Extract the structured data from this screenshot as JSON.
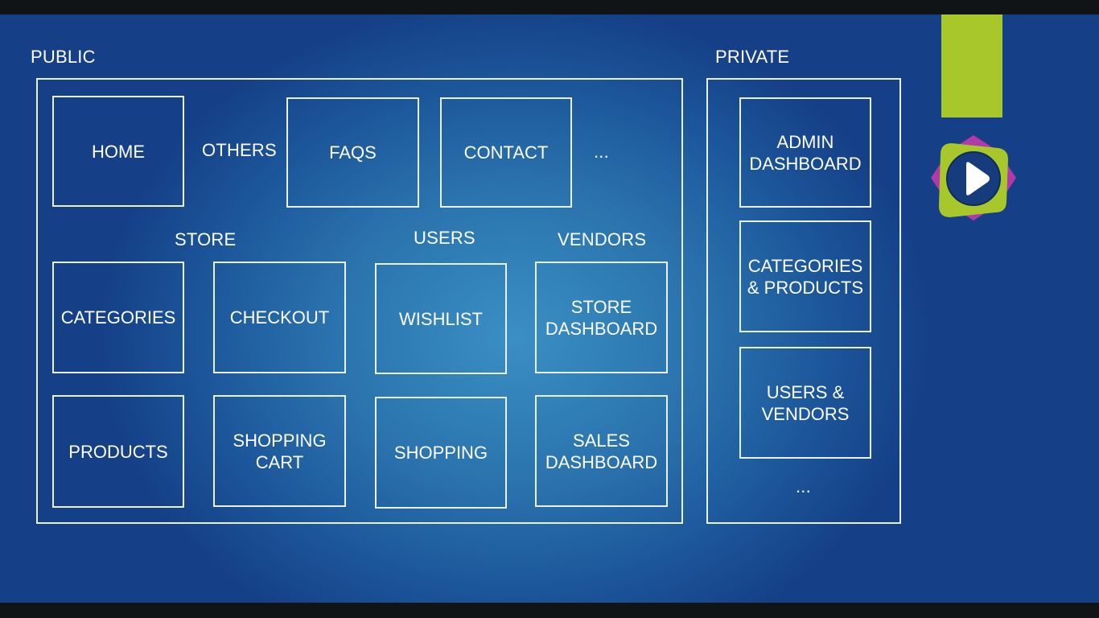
{
  "public": {
    "title": "PUBLIC",
    "others_label": "OTHERS",
    "others_more": "...",
    "store_label": "STORE",
    "users_label": "USERS",
    "vendors_label": "VENDORS",
    "boxes": {
      "home": "HOME",
      "faqs": "FAQS",
      "contact": "CONTACT",
      "categories": "CATEGORIES",
      "checkout": "CHECKOUT",
      "wishlist": "WISHLIST",
      "store_dashboard": "STORE\nDASHBOARD",
      "products": "PRODUCTS",
      "shopping_cart": "SHOPPING\nCART",
      "shopping": "SHOPPING",
      "sales_dashboard": "SALES\nDASHBOARD"
    }
  },
  "private": {
    "title": "PRIVATE",
    "more": "...",
    "boxes": {
      "admin_dashboard": "ADMIN\nDASHBOARD",
      "categories_products": "CATEGORIES\n& PRODUCTS",
      "users_vendors": "USERS &\nVENDORS"
    }
  },
  "colors": {
    "accent": "#a8c72a",
    "badge_magenta": "#b03aa8",
    "badge_navy": "#173c7e",
    "line": "#e9f1f7"
  },
  "icons": {
    "player": "play-icon"
  }
}
